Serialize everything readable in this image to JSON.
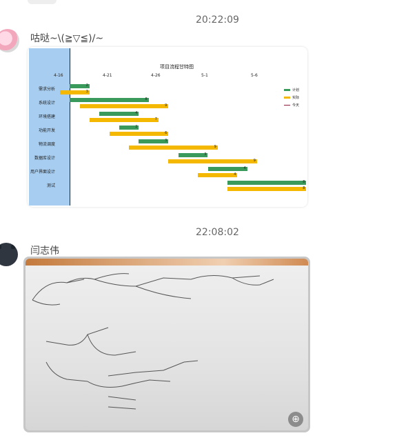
{
  "messages": [
    {
      "timestamp": "20:22:09",
      "sender": "咕哒~\\(≧▽≦)/~",
      "type": "image-chart",
      "avatar_icon": "anime-avatar-icon"
    },
    {
      "timestamp": "22:08:02",
      "sender": "闫志伟",
      "type": "image-photo",
      "avatar_icon": "cat-avatar-icon",
      "photo_description": "handwritten mind-map photo"
    }
  ],
  "chart_data": {
    "type": "bar",
    "title": "项目流程甘特图",
    "x_ticks": [
      "4-16",
      "4-21",
      "4-26",
      "5-1",
      "5-6"
    ],
    "categories": [
      "需求分析",
      "系统设计",
      "环境搭建",
      "功能开发",
      "物流调度",
      "数据库设计",
      "用户界面设计",
      "测试"
    ],
    "series": [
      {
        "name": "计划",
        "color": "#3a9a5b",
        "start_day": [
          1,
          1,
          4,
          6,
          8,
          12,
          15,
          17
        ],
        "duration": [
          2,
          8,
          4,
          2,
          3,
          3,
          4,
          8
        ]
      },
      {
        "name": "实际",
        "color": "#f5b800",
        "start_day": [
          0,
          2,
          3,
          5,
          7,
          11,
          14,
          17
        ],
        "duration": [
          3,
          9,
          7,
          6,
          9,
          9,
          4,
          8
        ]
      }
    ],
    "legend_extra": "今天",
    "legend_position": "top-right"
  },
  "ui": {
    "zoom_icon": "zoom-in-icon"
  }
}
